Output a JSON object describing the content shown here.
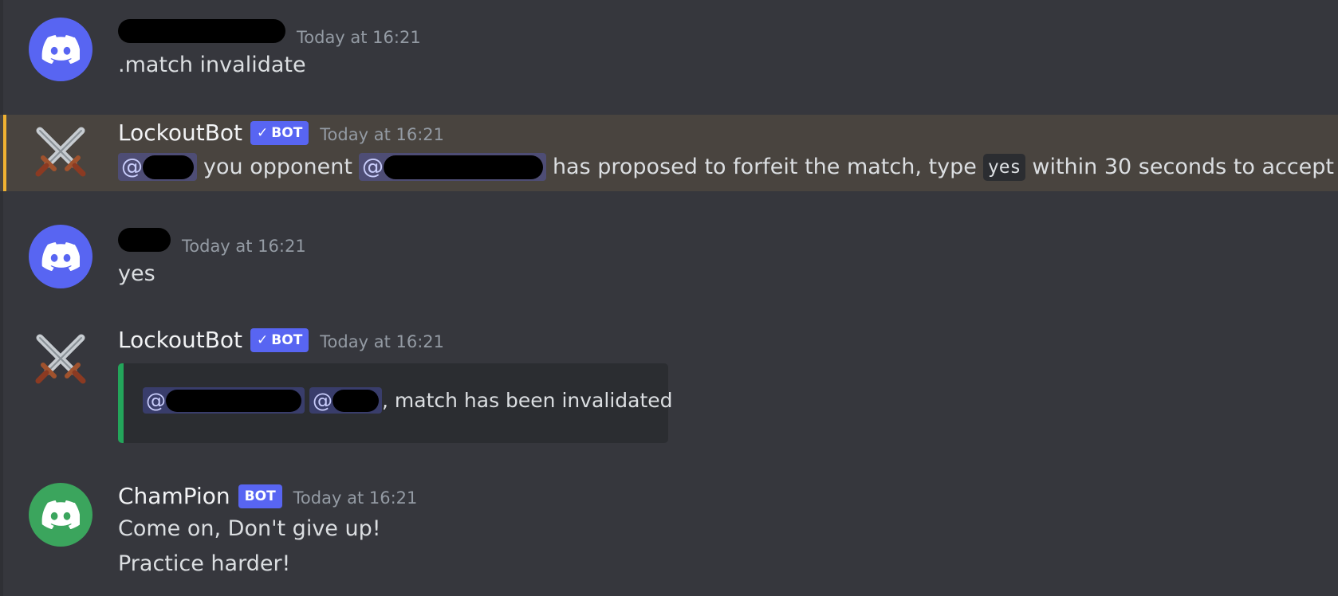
{
  "messages": [
    {
      "author_redacted": true,
      "timestamp": "Today at 16:21",
      "text": ".match invalidate",
      "avatar": "discord-logo-icon",
      "avatar_color": "#5865f2"
    },
    {
      "author": "LockoutBot",
      "badge": "BOT",
      "badge_verified": true,
      "timestamp": "Today at 16:21",
      "avatar": "crossed-swords-icon",
      "highlighted": true,
      "mention_prefix": "@",
      "text_part1": "you opponent",
      "text_part2": "has proposed to forfeit the match, type",
      "code": "yes",
      "text_part3": "within 30 seconds to accept"
    },
    {
      "author_redacted": true,
      "timestamp": "Today at 16:21",
      "text": "yes",
      "avatar": "discord-logo-icon",
      "avatar_color": "#5865f2"
    },
    {
      "author": "LockoutBot",
      "badge": "BOT",
      "badge_verified": true,
      "timestamp": "Today at 16:21",
      "avatar": "crossed-swords-icon",
      "embed": {
        "mention_prefix": "@",
        "text": ", match has been invalidated",
        "border_color": "#23a55a"
      }
    },
    {
      "author": "ChamPion",
      "badge": "BOT",
      "badge_verified": false,
      "timestamp": "Today at 16:21",
      "avatar": "discord-logo-icon",
      "avatar_color": "#3ba55d",
      "line1": "Come on, Don't give up!",
      "line2": "Practice harder!"
    }
  ]
}
